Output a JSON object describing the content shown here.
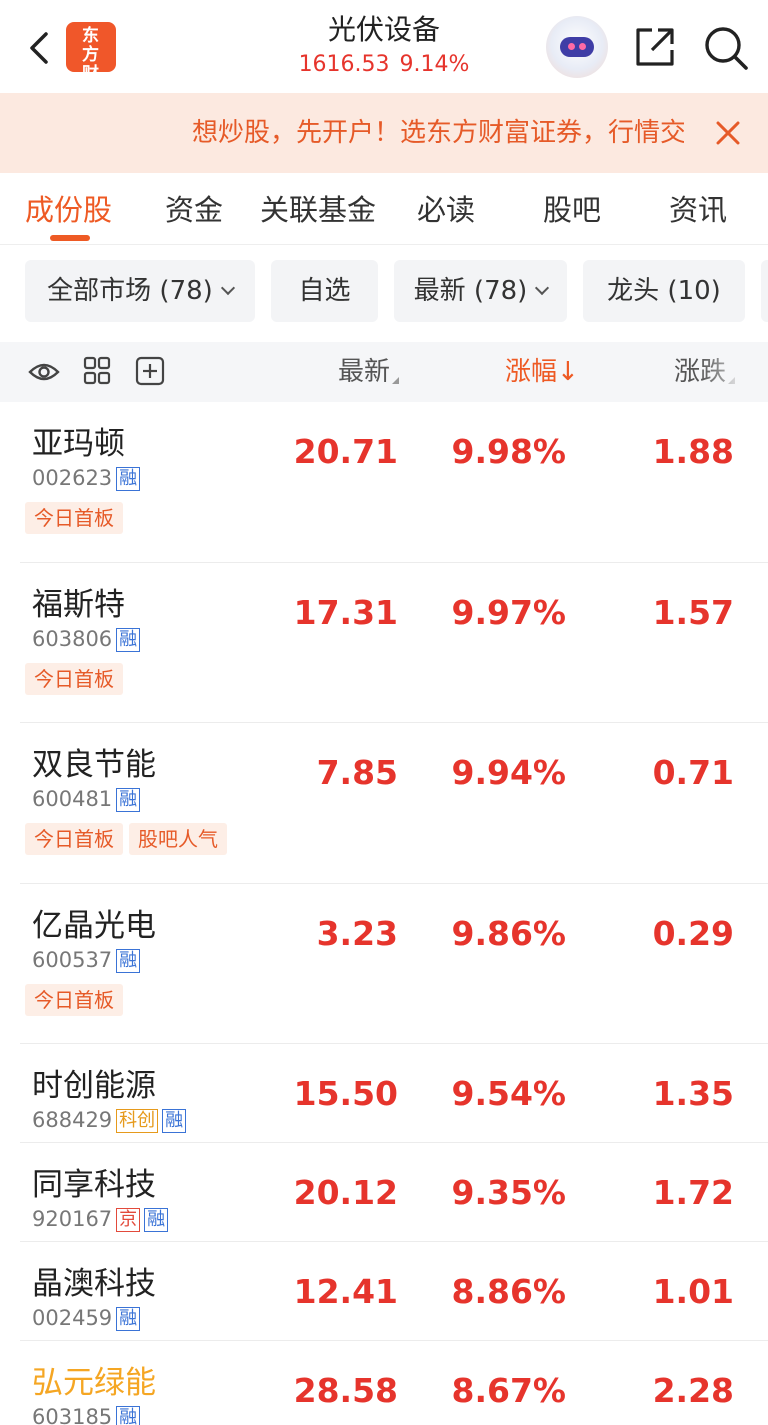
{
  "header": {
    "logo_text": "东方财富",
    "title": "光伏设备",
    "index_value": "1616.53",
    "index_change": "9.14%"
  },
  "banner": {
    "text": "想炒股，先开户！选东方财富证券，行情交易一站式"
  },
  "tabs": [
    {
      "label": "成份股",
      "active": true
    },
    {
      "label": "资金"
    },
    {
      "label": "关联基金"
    },
    {
      "label": "必读"
    },
    {
      "label": "股吧"
    },
    {
      "label": "资讯"
    }
  ],
  "filters": [
    {
      "label": "全部市场 (78)",
      "dropdown": true
    },
    {
      "label": "自选",
      "dropdown": false
    },
    {
      "label": "最新 (78)",
      "dropdown": true
    },
    {
      "label": "龙头 (10)",
      "dropdown": false
    }
  ],
  "columns": {
    "price": "最新",
    "pct": "涨幅",
    "pct_sort_arrow": "↓",
    "change": "涨跌"
  },
  "colors": {
    "accent": "#ee5a24",
    "up_red": "#e6342c",
    "banner_bg": "#fce9e0",
    "rong_blue": "#3a73d6"
  },
  "stocks": [
    {
      "name": "亚玛顿",
      "code": "002623",
      "badges": [
        "融"
      ],
      "tags": [
        "今日首板"
      ],
      "price": "20.71",
      "pct": "9.98%",
      "change": "1.88"
    },
    {
      "name": "福斯特",
      "code": "603806",
      "badges": [
        "融"
      ],
      "tags": [
        "今日首板"
      ],
      "price": "17.31",
      "pct": "9.97%",
      "change": "1.57"
    },
    {
      "name": "双良节能",
      "code": "600481",
      "badges": [
        "融"
      ],
      "tags": [
        "今日首板",
        "股吧人气"
      ],
      "price": "7.85",
      "pct": "9.94%",
      "change": "0.71"
    },
    {
      "name": "亿晶光电",
      "code": "600537",
      "badges": [
        "融"
      ],
      "tags": [
        "今日首板"
      ],
      "price": "3.23",
      "pct": "9.86%",
      "change": "0.29"
    },
    {
      "name": "时创能源",
      "code": "688429",
      "badges": [
        "科创",
        "融"
      ],
      "tags": [],
      "price": "15.50",
      "pct": "9.54%",
      "change": "1.35"
    },
    {
      "name": "同享科技",
      "code": "920167",
      "badges": [
        "京",
        "融"
      ],
      "tags": [],
      "price": "20.12",
      "pct": "9.35%",
      "change": "1.72"
    },
    {
      "name": "晶澳科技",
      "code": "002459",
      "badges": [
        "融"
      ],
      "tags": [],
      "price": "12.41",
      "pct": "8.86%",
      "change": "1.01"
    },
    {
      "name": "弘元绿能",
      "code": "603185",
      "badges": [
        "融"
      ],
      "tags": [],
      "price": "28.58",
      "pct": "8.67%",
      "change": "2.28",
      "highlight": true
    }
  ]
}
